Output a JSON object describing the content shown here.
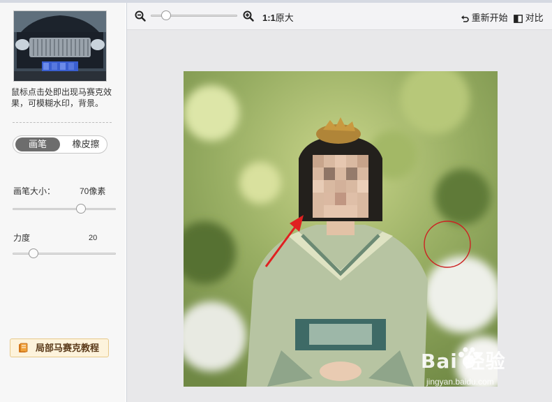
{
  "sidebar": {
    "thumbnail_alt": "car-photo",
    "description": "鼠标点击处即出现马赛克效果，可模糊水印，背景。",
    "mode_toggle": {
      "active": "画笔",
      "inactive": "橡皮擦"
    },
    "brush_size": {
      "label": "画笔大小：",
      "value": "70像素",
      "level": 0.66
    },
    "strength": {
      "label": "力度",
      "value": "20",
      "level": 0.2
    },
    "tutorial_button": "局部马赛克教程"
  },
  "toolbar": {
    "zoom_level": 0.18,
    "original_size_bold": "1:1",
    "original_size_text": "原大",
    "reset_label": "重新开始",
    "compare_label": "对比"
  },
  "canvas": {
    "watermark_text": "Bai 经验",
    "watermark_url": "jingyan.baidu.com"
  },
  "colors": {
    "accent": "#6d6d6d",
    "annotation": "#e02020",
    "tutorial_bg": "#fdf3dc"
  },
  "icons": [
    "zoom-out-icon",
    "zoom-in-icon",
    "undo-icon",
    "compare-icon",
    "book-icon",
    "paw-icon"
  ]
}
